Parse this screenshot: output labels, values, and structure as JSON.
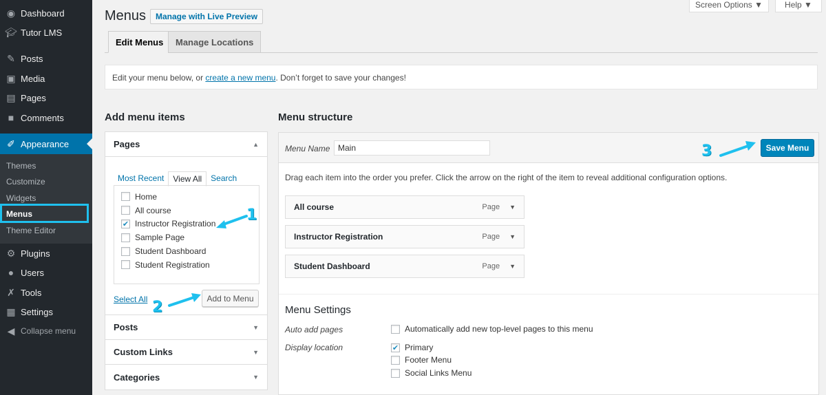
{
  "sidebar": {
    "items": [
      {
        "label": "Dashboard",
        "icon": "dashboard-icon"
      },
      {
        "label": "Tutor LMS",
        "icon": "graduation-cap-icon"
      },
      {
        "label": "Posts",
        "icon": "pin-icon"
      },
      {
        "label": "Media",
        "icon": "media-icon"
      },
      {
        "label": "Pages",
        "icon": "pages-icon"
      },
      {
        "label": "Comments",
        "icon": "comment-icon"
      },
      {
        "label": "Appearance",
        "icon": "paintbrush-icon"
      },
      {
        "label": "Plugins",
        "icon": "plugin-icon"
      },
      {
        "label": "Users",
        "icon": "users-icon"
      },
      {
        "label": "Tools",
        "icon": "wrench-icon"
      },
      {
        "label": "Settings",
        "icon": "settings-icon"
      },
      {
        "label": "Collapse menu",
        "icon": "collapse-icon"
      }
    ],
    "submenu": [
      "Themes",
      "Customize",
      "Widgets",
      "Menus",
      "Theme Editor"
    ]
  },
  "header": {
    "title": "Menus",
    "live_preview": "Manage with Live Preview",
    "screen_options": "Screen Options ▼",
    "help": "Help ▼",
    "tabs": [
      "Edit Menus",
      "Manage Locations"
    ]
  },
  "notice": {
    "before": "Edit your menu below, or ",
    "link": "create a new menu",
    "after": ". Don’t forget to save your changes!"
  },
  "add_items": {
    "title": "Add menu items",
    "pages_title": "Pages",
    "inner_tabs": [
      "Most Recent",
      "View All",
      "Search"
    ],
    "pages": [
      {
        "label": "Home",
        "checked": false
      },
      {
        "label": "All course",
        "checked": false
      },
      {
        "label": "Instructor Registration",
        "checked": true
      },
      {
        "label": "Sample Page",
        "checked": false
      },
      {
        "label": "Student Dashboard",
        "checked": false
      },
      {
        "label": "Student Registration",
        "checked": false
      }
    ],
    "select_all": "Select All",
    "add_button": "Add to Menu",
    "sections": [
      "Posts",
      "Custom Links",
      "Categories"
    ]
  },
  "structure": {
    "title": "Menu structure",
    "menu_name_label": "Menu Name",
    "menu_name_value": "Main",
    "save_button": "Save Menu",
    "instructions": "Drag each item into the order you prefer. Click the arrow on the right of the item to reveal additional configuration options.",
    "items": [
      {
        "title": "All course",
        "type": "Page"
      },
      {
        "title": "Instructor Registration",
        "type": "Page"
      },
      {
        "title": "Student Dashboard",
        "type": "Page"
      }
    ],
    "settings_title": "Menu Settings",
    "auto_add_label": "Auto add pages",
    "auto_add_text": "Automatically add new top-level pages to this menu",
    "display_location_label": "Display location",
    "locations": [
      {
        "label": "Primary",
        "checked": true
      },
      {
        "label": "Footer Menu",
        "checked": false
      },
      {
        "label": "Social Links Menu",
        "checked": false
      }
    ]
  },
  "annotations": [
    "1",
    "2",
    "3"
  ],
  "colors": {
    "accent": "#0073aa",
    "highlight": "#1fc0ee",
    "sidebar": "#23282d"
  }
}
